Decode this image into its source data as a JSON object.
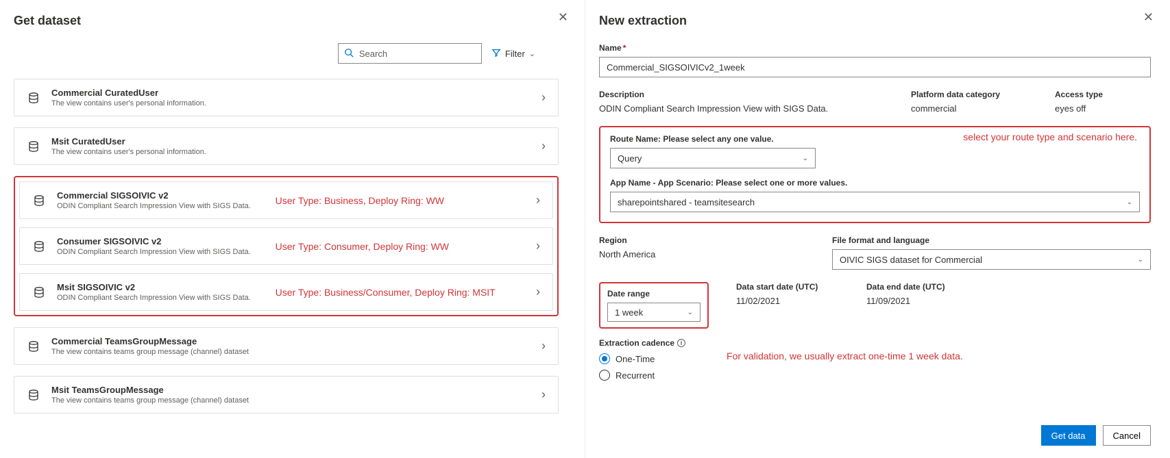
{
  "left": {
    "title": "Get dataset",
    "search_placeholder": "Search",
    "filter_label": "Filter",
    "datasets": [
      {
        "title": "Commercial CuratedUser",
        "desc": "The view contains user's personal information.",
        "ann": ""
      },
      {
        "title": "Msit CuratedUser",
        "desc": "The view contains user's personal information.",
        "ann": ""
      },
      {
        "title": "Commercial SIGSOIVIC v2",
        "desc": "ODIN Compliant Search Impression View with SIGS Data.",
        "ann": "User Type: Business, Deploy Ring: WW"
      },
      {
        "title": "Consumer SIGSOIVIC v2",
        "desc": "ODIN Compliant Search Impression View with SIGS Data.",
        "ann": "User Type: Consumer, Deploy Ring: WW"
      },
      {
        "title": "Msit SIGSOIVIC v2",
        "desc": "ODIN Compliant Search Impression View with SIGS Data.",
        "ann": "User Type: Business/Consumer, Deploy Ring: MSIT"
      },
      {
        "title": "Commercial TeamsGroupMessage",
        "desc": "The view contains teams group message (channel) dataset",
        "ann": ""
      },
      {
        "title": "Msit TeamsGroupMessage",
        "desc": "The view contains teams group message (channel) dataset",
        "ann": ""
      }
    ]
  },
  "right": {
    "title": "New extraction",
    "name_label": "Name",
    "name_value": "Commercial_SIGSOIVICv2_1week",
    "desc_label": "Description",
    "desc_value": "ODIN Compliant Search Impression View with SIGS Data.",
    "platform_label": "Platform data category",
    "platform_value": "commercial",
    "access_label": "Access type",
    "access_value": "eyes off",
    "route_label": "Route Name: Please select any one value.",
    "route_value": "Query",
    "route_ann": "select your route type and scenario here.",
    "app_label": "App Name - App Scenario: Please select one or more values.",
    "app_value": "sharepointshared - teamsitesearch",
    "region_label": "Region",
    "region_value": "North America",
    "file_label": "File format and language",
    "file_value": "OIVIC SIGS dataset for Commercial",
    "date_range_label": "Date range",
    "date_range_value": "1 week",
    "data_start_label": "Data start date (UTC)",
    "data_start_value": "11/02/2021",
    "data_end_label": "Data end date (UTC)",
    "data_end_value": "11/09/2021",
    "cadence_label": "Extraction cadence",
    "cadence_opts": {
      "one": "One-Time",
      "rec": "Recurrent"
    },
    "cadence_ann": "For validation, we usually extract one-time 1 week data.",
    "get_data": "Get data",
    "cancel": "Cancel"
  }
}
